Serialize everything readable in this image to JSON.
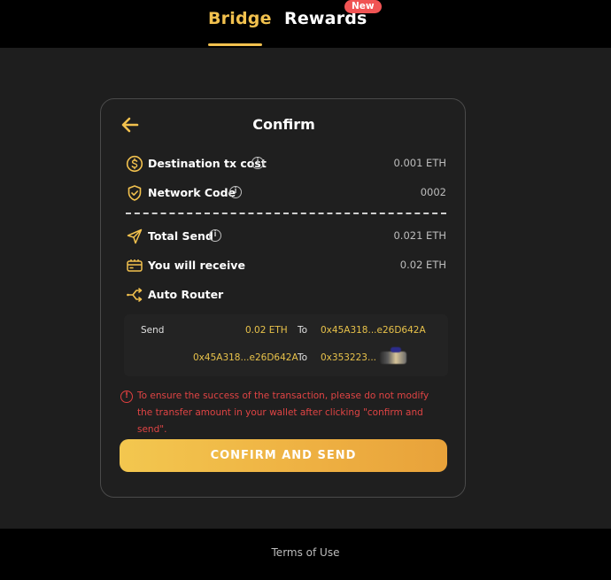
{
  "nav": {
    "tabs": [
      {
        "label": "Bridge",
        "active": true
      },
      {
        "label": "Rewards",
        "active": false
      }
    ],
    "new_badge": "New"
  },
  "confirm": {
    "title": "Confirm",
    "rows": {
      "destination_tx_cost": {
        "label": "Destination tx cost",
        "value": "0.001 ETH",
        "icon": "dollar-coin-icon"
      },
      "network_code": {
        "label": "Network Code",
        "value": "0002",
        "icon": "shield-check-icon"
      },
      "total_send": {
        "label": "Total Send",
        "value": "0.021 ETH",
        "icon": "send-plane-icon"
      },
      "you_will_receive": {
        "label": "You will receive",
        "value": "0.02 ETH",
        "icon": "wallet-card-icon"
      },
      "auto_router": {
        "label": "Auto Router",
        "icon": "route-split-icon"
      }
    },
    "route": {
      "line1": {
        "send_label": "Send",
        "amount": "0.02 ETH",
        "to_label": "To",
        "to_address": "0x45A318...e26D642A"
      },
      "line2": {
        "from_address": "0x45A318...e26D642A",
        "to_label": "To",
        "to_address": "0x353223..."
      }
    },
    "warning": "To ensure the success of the transaction, please do not modify the transfer amount in your wallet after clicking \"confirm and send\".",
    "confirm_button": "CONFIRM AND SEND"
  },
  "footer": {
    "terms": "Terms of Use"
  },
  "colors": {
    "accent": "#f2c14e",
    "background": "#1e1e1e",
    "card_border": "#4a4a4a",
    "warning": "#e04444",
    "badge": "#f05454"
  }
}
